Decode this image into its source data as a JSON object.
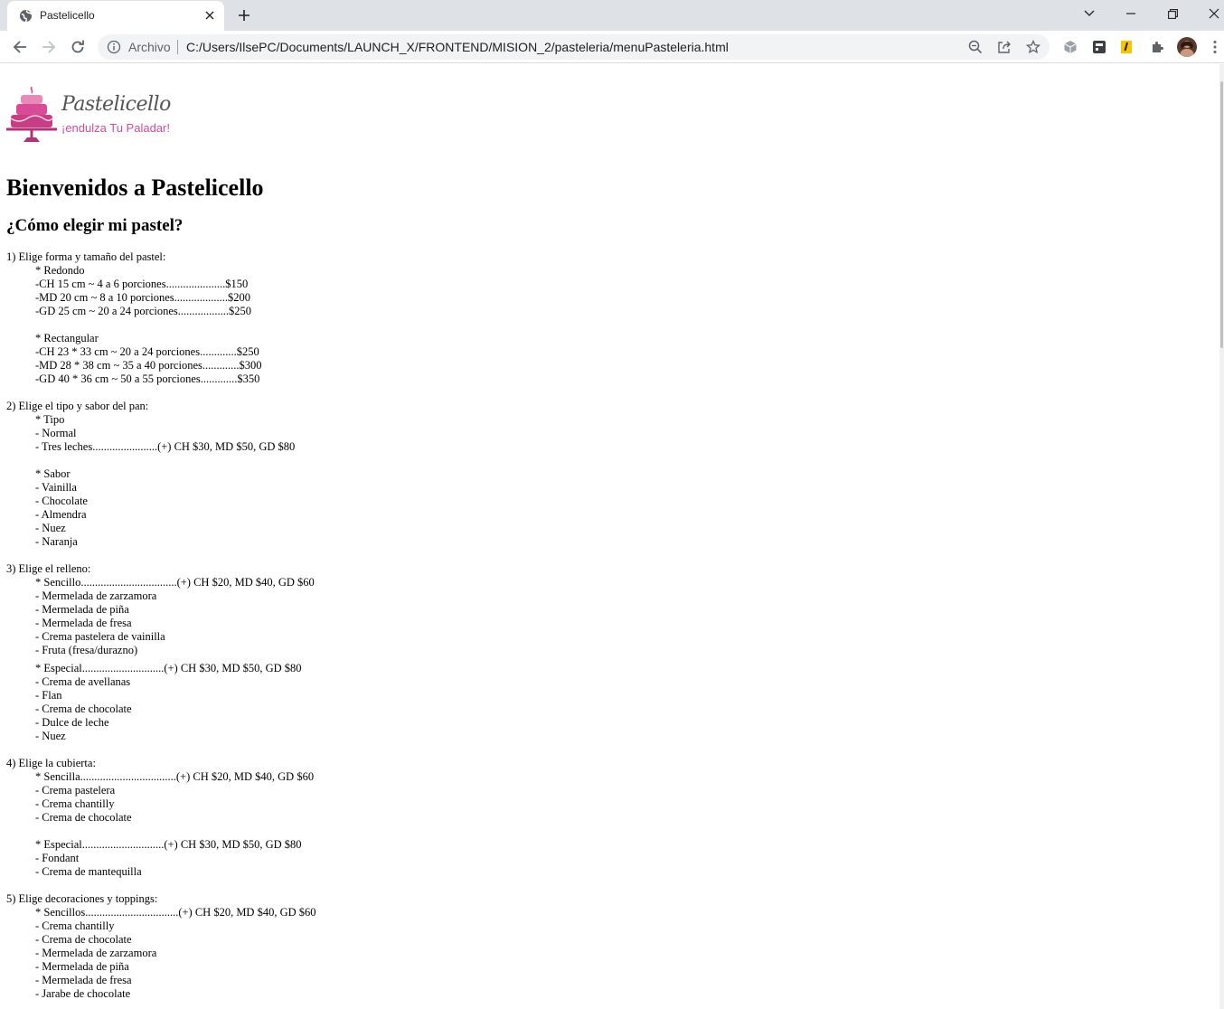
{
  "browser": {
    "tab_title": "Pastelicello",
    "omnibox_label": "Archivo",
    "url": "C:/Users/IlsePC/Documents/LAUNCH_X/FRONTEND/MISION_2/pasteleria/menuPasteleria.html",
    "icons": [
      "globe-icon",
      "close-icon",
      "plus-icon",
      "chevron-down-icon",
      "minimize-icon",
      "restore-icon",
      "window-close-icon",
      "back-arrow-icon",
      "forward-arrow-icon",
      "reload-icon",
      "info-icon",
      "zoom-icon",
      "share-icon",
      "star-icon",
      "cube-icon",
      "extension-icon",
      "puzzle-icon",
      "avatar",
      "kebab-menu-icon"
    ]
  },
  "page": {
    "logo": {
      "name": "Pastelicello",
      "tagline": "¡endulza Tu Paladar!"
    },
    "title": "Bienvenidos a Pastelicello",
    "subtitle": "¿Cómo elegir mi pastel?",
    "steps": [
      {
        "heading": "1) Elige forma y tamaño del pastel:",
        "groups": [
          {
            "title": "* Redondo",
            "items": [
              "-CH 15 cm ~ 4 a 6 porciones.....................$150",
              "-MD 20 cm ~ 8 a 10 porciones...................$200",
              "-GD 25 cm ~ 20 a 24 porciones..................$250"
            ]
          },
          {
            "title": "* Rectangular",
            "items": [
              "-CH 23 * 33 cm ~ 20 a 24 porciones.............$250",
              "-MD 28 * 38 cm ~ 35 a 40 porciones.............$300",
              "-GD 40 * 36 cm ~ 50 a 55 porciones.............$350"
            ]
          }
        ]
      },
      {
        "heading": "2) Elige el tipo y sabor del pan:",
        "groups": [
          {
            "title": "* Tipo",
            "items": [
              "- Normal",
              "- Tres leches.......................(+) CH $30, MD $50, GD $80"
            ]
          },
          {
            "title": "* Sabor",
            "items": [
              "- Vainilla",
              "- Chocolate",
              "- Almendra",
              "- Nuez",
              "- Naranja"
            ]
          }
        ]
      },
      {
        "heading": "3) Elige el relleno:",
        "groups": [
          {
            "title": "* Sencillo..................................(+) CH $20, MD $40, GD $60",
            "items": [
              "- Mermelada de zarzamora",
              "- Mermelada de piña",
              "- Mermelada de fresa",
              "- Crema pastelera de vainilla",
              "- Fruta (fresa/durazno)"
            ]
          },
          {
            "title": "* Especial.............................(+) CH $30, MD $50, GD $80",
            "items": [
              "- Crema de avellanas",
              "- Flan",
              "- Crema de chocolate",
              "- Dulce de leche",
              "- Nuez"
            ]
          }
        ]
      },
      {
        "heading": "4) Elige la cubierta:",
        "groups": [
          {
            "title": "* Sencilla..................................(+) CH $20, MD $40, GD $60",
            "items": [
              "- Crema pastelera",
              "- Crema chantilly",
              "- Crema de chocolate"
            ]
          },
          {
            "title": "* Especial.............................(+) CH $30, MD $50, GD $80",
            "items": [
              "- Fondant",
              "- Crema de mantequilla"
            ]
          }
        ]
      },
      {
        "heading": "5) Elige decoraciones y toppings:",
        "groups": [
          {
            "title": "* Sencillos.................................(+) CH $20, MD $40, GD $60",
            "items": [
              "- Crema chantilly",
              "- Crema de chocolate",
              "- Mermelada de zarzamora",
              "- Mermelada de piña",
              "- Mermelada de fresa",
              "- Jarabe de chocolate"
            ]
          }
        ]
      }
    ]
  },
  "colors": {
    "tabstrip": "#dee1e6",
    "omnibox": "#f1f3f4",
    "brand_pink": "#d84b96"
  }
}
